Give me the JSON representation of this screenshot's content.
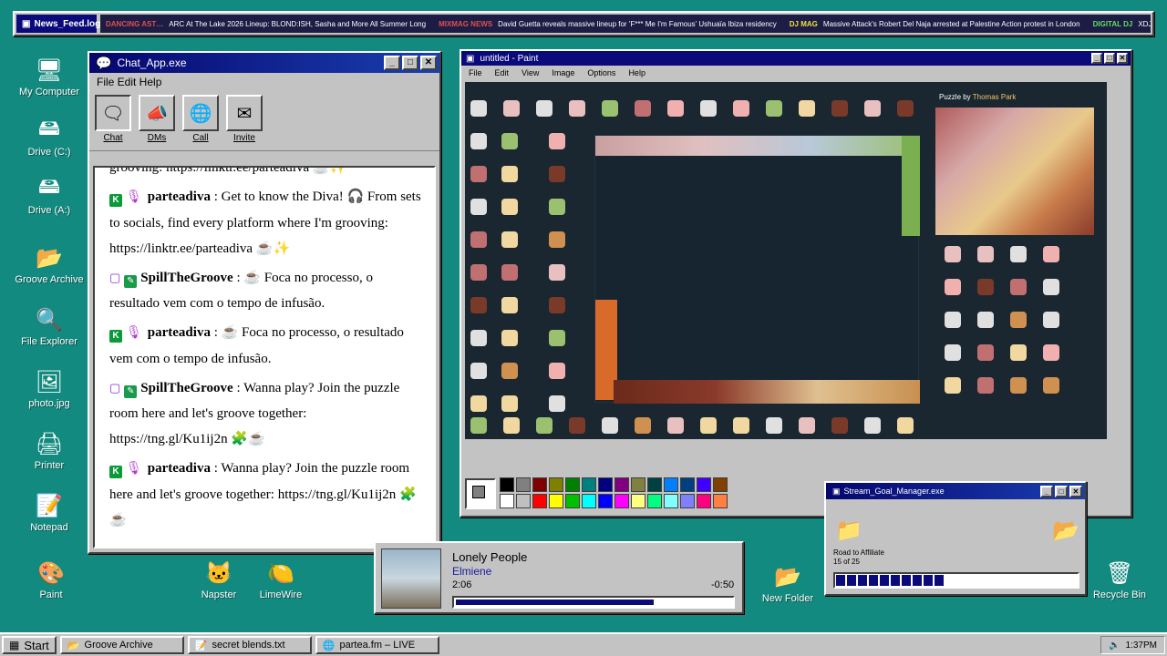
{
  "newsbar": {
    "title": "News_Feed.log",
    "items": [
      {
        "source": "DANCING AST…",
        "source_color": "#e05050",
        "headline": "ARC At The Lake 2026 Lineup: BLOND:ISH, Sasha and More All Summer Long"
      },
      {
        "source": "MIXMAG NEWS",
        "source_color": "#e05050",
        "headline": "David Guetta reveals massive lineup for 'F*** Me I'm Famous' Ushuaïa Ibiza residency"
      },
      {
        "source": "DJ MAG",
        "source_color": "#f0e040",
        "headline": "Massive Attack's Robert Del Naja arrested at Palestine Action protest in London"
      },
      {
        "source": "DIGITAL DJ",
        "source_color": "#60e060",
        "headline": "XDJ-AZ Firmwa…"
      }
    ]
  },
  "desktop_icons": [
    {
      "label": "My Computer",
      "icon": "computer-icon"
    },
    {
      "label": "Drive (C:)",
      "icon": "drive-icon"
    },
    {
      "label": "Drive (A:)",
      "icon": "floppy-drive-icon"
    },
    {
      "label": "Groove Archive",
      "icon": "folder-icon"
    },
    {
      "label": "File Explorer",
      "icon": "magnifier-icon"
    },
    {
      "label": "photo.jpg",
      "icon": "image-file-icon"
    },
    {
      "label": "Printer",
      "icon": "printer-icon"
    },
    {
      "label": "Notepad",
      "icon": "notepad-icon"
    },
    {
      "label": "Paint",
      "icon": "paint-icon"
    },
    {
      "label": "Napster",
      "icon": "napster-icon"
    },
    {
      "label": "LimeWire",
      "icon": "limewire-icon"
    },
    {
      "label": "New Folder",
      "icon": "folder-icon"
    },
    {
      "label": "Recycle Bin",
      "icon": "recycle-bin-icon"
    }
  ],
  "chat": {
    "title": "Chat_App.exe",
    "menu": "File Edit Help",
    "tools": [
      "Chat",
      "DMs",
      "Call",
      "Invite"
    ],
    "partial_line": "grooving: https://linktr.ee/parteadiva",
    "messages": [
      {
        "platform": "kick",
        "user": "parteadiva",
        "text": ": Get to know the Diva! 🎧 From sets to socials, find every platform where I'm grooving: https://linktr.ee/parteadiva ☕✨"
      },
      {
        "platform": "twitch",
        "user": "SpillTheGroove",
        "text": ": ☕ Foca no processo, o resultado vem com o tempo de infusão."
      },
      {
        "platform": "kick",
        "user": "parteadiva",
        "text": ": ☕ Foca no processo, o resultado vem com o tempo de infusão."
      },
      {
        "platform": "twitch",
        "user": "SpillTheGroove",
        "text": ": Wanna play? Join the puzzle room here and let's groove together: https://tng.gl/Ku1ij2n 🧩☕"
      },
      {
        "platform": "kick",
        "user": "parteadiva",
        "text": ": Wanna play? Join the puzzle room here and let's groove together: https://tng.gl/Ku1ij2n 🧩☕"
      }
    ]
  },
  "paint": {
    "title": "untitled - Paint",
    "menu": [
      "File",
      "Edit",
      "View",
      "Image",
      "Options",
      "Help"
    ],
    "puzzle_by": "Puzzle by",
    "puzzle_author": "Thomas Park",
    "palette": [
      "#000000",
      "#808080",
      "#800000",
      "#808000",
      "#008000",
      "#008080",
      "#000080",
      "#800080",
      "#808040",
      "#004040",
      "#0080ff",
      "#004080",
      "#4000ff",
      "#804000",
      "#ffffff",
      "#c0c0c0",
      "#ff0000",
      "#ffff00",
      "#00c000",
      "#00ffff",
      "#0000ff",
      "#ff00ff",
      "#ffff80",
      "#00ff80",
      "#80ffff",
      "#8080ff",
      "#ff0080",
      "#ff8040"
    ]
  },
  "goal": {
    "title": "Stream_Goal_Manager.exe",
    "label": "Road to Affiliate",
    "count": "15 of 25",
    "progress": 0.6
  },
  "music": {
    "title": "Lonely People",
    "artist": "Elmiene",
    "elapsed": "2:06",
    "remaining": "-0:50",
    "progress": 0.72
  },
  "taskbar": {
    "start": "Start",
    "items": [
      "Groove Archive",
      "secret blends.txt",
      "partea.fm – LIVE"
    ],
    "clock": "1:37PM"
  }
}
